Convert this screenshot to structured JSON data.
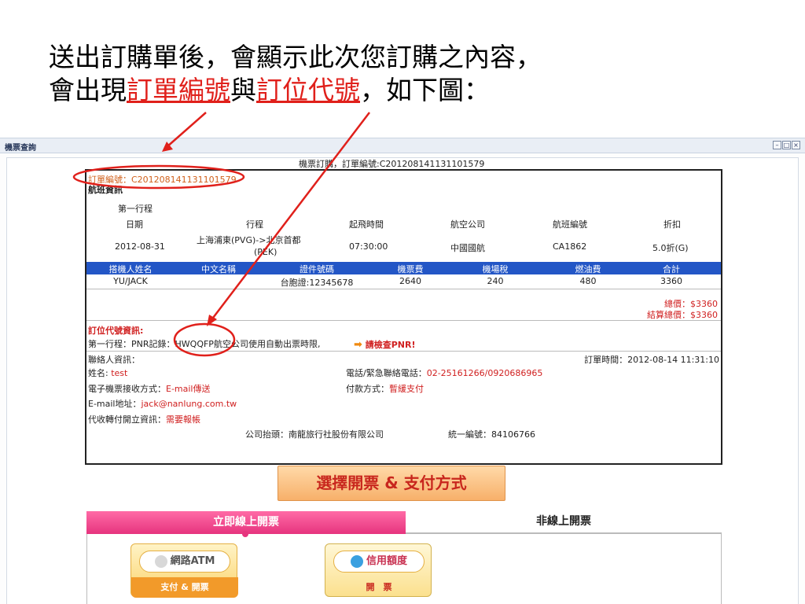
{
  "slide": {
    "line1": "送出訂購單後，會顯示此次您訂購之內容，",
    "line2_pre": "會出現",
    "line2_hl1": "訂單編號",
    "line2_mid": "與",
    "line2_hl2": "訂位代號",
    "line2_post": "，如下圖："
  },
  "window": {
    "title": "機票查詢",
    "buttons": [
      "–",
      "□",
      "×"
    ]
  },
  "order": {
    "top_label": "機票訂購，訂單編號:C20120814113110157​9",
    "order_no": "訂單編號：C201208141131101579",
    "flight_info_label": "航班資訊",
    "segment_label": "第一行程",
    "flight_headers": [
      "日期",
      "行程",
      "起飛時間",
      "航空公司",
      "航班編號",
      "折扣"
    ],
    "flight_row": {
      "date": "2012-08-31",
      "route1": "上海浦東(PVG)->北京首都",
      "route2": "(PEK)",
      "time": "07:30:00",
      "airline": "中國國航",
      "flight_no": "CA1862",
      "discount": "5.0折(G)"
    },
    "pax_headers": [
      "搭機人姓名",
      "中文名稱",
      "證件號碼",
      "機票費",
      "機場稅",
      "燃油費",
      "合計"
    ],
    "pax_row": [
      "YU/JACK",
      "",
      "台胞證:12345678",
      "2640",
      "240",
      "480",
      "3360"
    ],
    "total": "總價：$3360",
    "settle_total": "結算總價：$3360",
    "booking_label": "訂位代號資訊:",
    "pnr_line_pre": "第一行程：PNR記錄：",
    "pnr_code": "HWQQFP",
    "pnr_line_post": "航空公司使用自動出票時限,",
    "pnr_check": "請檢查PNR!",
    "contact_label": "聯絡人資訊：",
    "order_time_label": "訂單時間：",
    "order_time": "2012-08-14 11:31:10",
    "name_label": "姓名:",
    "name": "test",
    "phone_label": "電話/緊急聯絡電話：",
    "phone": "02-25161266/0920686965",
    "eticket_label": "電子機票接收方式：",
    "eticket": "E-mail傳送",
    "payment_label": "付款方式：",
    "payment": "暫緩支付",
    "email_label": "E-mail地址：",
    "email": "jack@nanlung.com.tw",
    "invoice_label": "代收轉付開立資訊：",
    "invoice": "需要報帳",
    "company_label": "公司抬頭：",
    "company": "南龍旅行社股份有限公司",
    "tax_label": "統一編號：",
    "tax_id": "84106766"
  },
  "payment_section": {
    "title": "選擇開票 & 支付方式",
    "tab_online": "立即線上開票",
    "tab_offline": "非線上開票",
    "atm_top": "網路ATM",
    "atm_bottom": "支付 & 開票",
    "credit_top": "信用額度",
    "credit_bottom": "開　票"
  },
  "colors": {
    "highlight_red": "#e0201b",
    "table_header_blue": "#2356c6",
    "tab_pink": "#e6347e"
  }
}
